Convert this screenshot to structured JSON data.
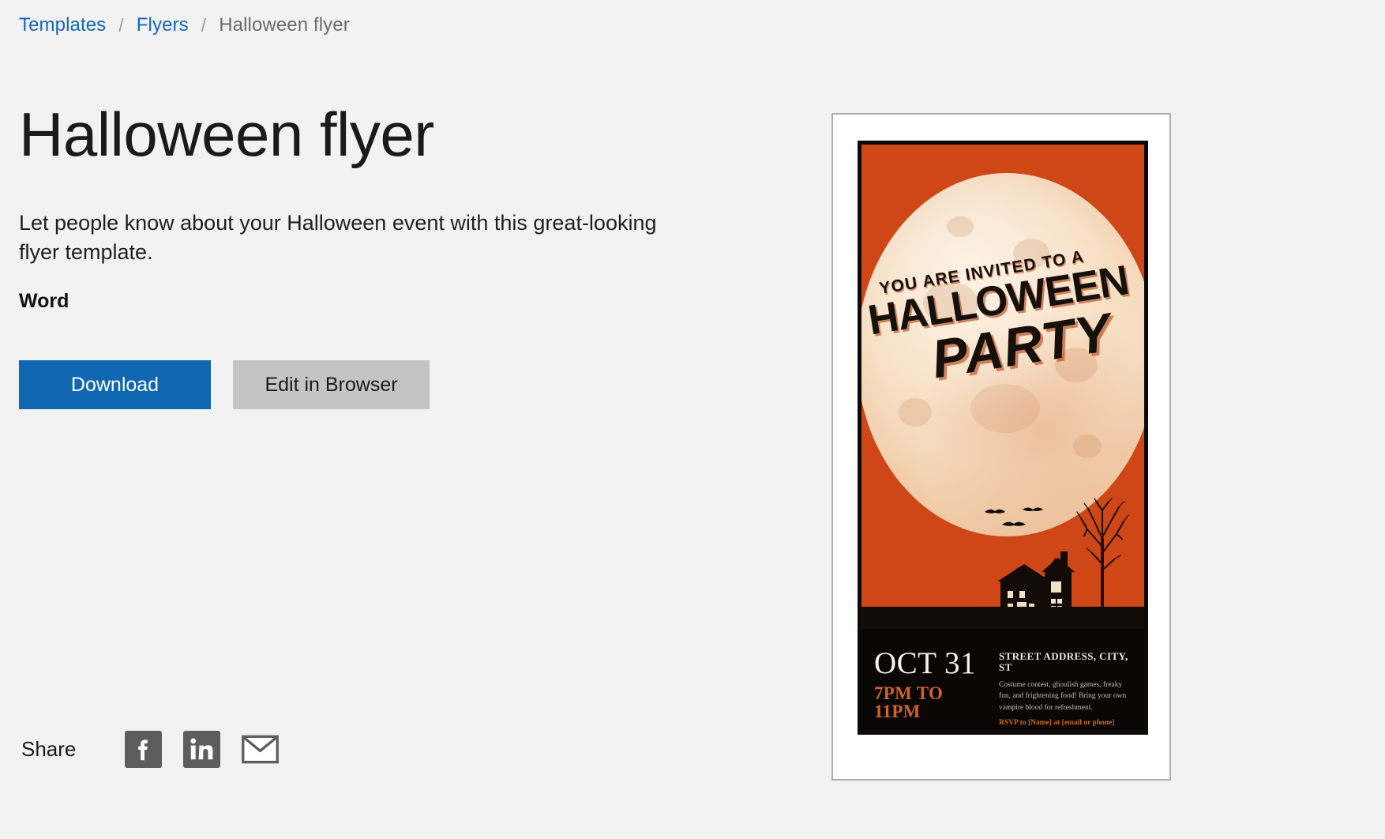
{
  "breadcrumb": {
    "items": [
      {
        "label": "Templates",
        "current": false
      },
      {
        "label": "Flyers",
        "current": false
      },
      {
        "label": "Halloween flyer",
        "current": true
      }
    ],
    "separator": "/"
  },
  "main": {
    "title": "Halloween flyer",
    "description": "Let people know about your Halloween event with this great-looking flyer template.",
    "format": "Word",
    "download_label": "Download",
    "edit_label": "Edit in Browser"
  },
  "share": {
    "label": "Share",
    "icons": [
      {
        "name": "facebook-icon",
        "glyph": "f"
      },
      {
        "name": "linkedin-icon",
        "glyph": "in"
      },
      {
        "name": "email-icon",
        "glyph": "envelope"
      }
    ]
  },
  "preview": {
    "poster": {
      "invited_line": "YOU ARE INVITED TO A",
      "title_line1": "HALLOWEEN",
      "title_line2": "PARTY",
      "date": "OCT 31",
      "time": "7PM TO 11PM",
      "address": "STREET ADDRESS, CITY, ST",
      "body": "Costume contest, ghoulish games, freaky fun, and frightening food! Bring your own vampire blood for refreshment.",
      "rsvp": "RSVP to [Name] at [email or phone]"
    }
  },
  "colors": {
    "page_background": "#f2f2f2",
    "link_blue": "#1466b8",
    "primary_button": "#0f67b1",
    "secondary_button": "#c4c4c4",
    "share_icon_gray": "#5d5d5d",
    "poster_orange": "#cf4716",
    "poster_black": "#0a0604",
    "poster_accent_orange": "#d2622a",
    "moon_cream": "#f6ddc0"
  }
}
